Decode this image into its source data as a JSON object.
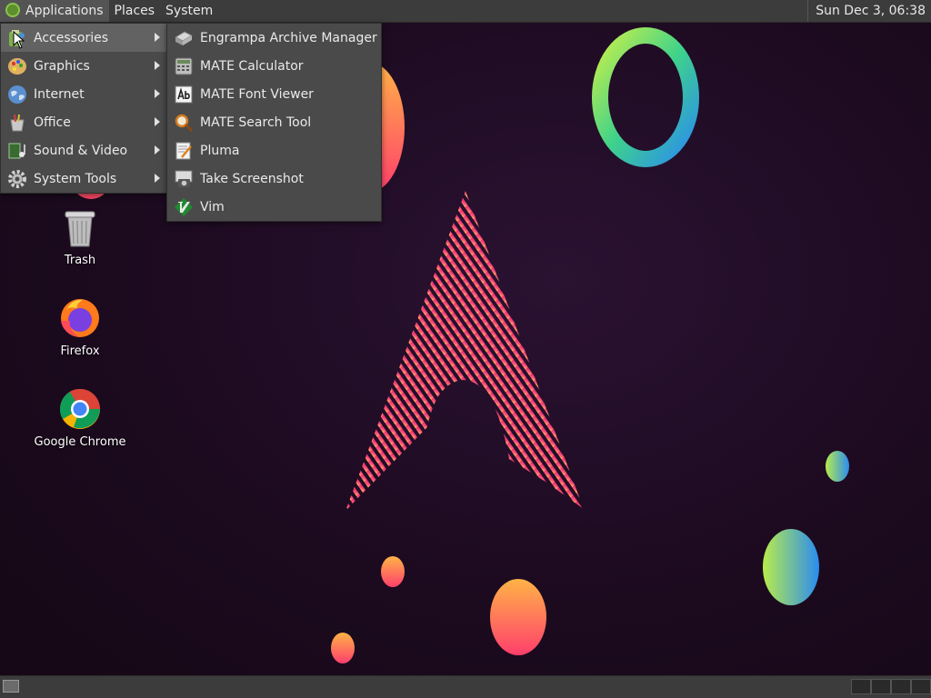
{
  "top_panel": {
    "menus": [
      "Applications",
      "Places",
      "System"
    ],
    "clock": "Sun Dec  3, 06:38"
  },
  "applications_menu": [
    {
      "label": "Accessories",
      "icon": "accessories-icon",
      "highlighted": true
    },
    {
      "label": "Graphics",
      "icon": "graphics-icon"
    },
    {
      "label": "Internet",
      "icon": "internet-globe-icon"
    },
    {
      "label": "Office",
      "icon": "office-icon"
    },
    {
      "label": "Sound & Video",
      "icon": "sound-video-icon"
    },
    {
      "label": "System Tools",
      "icon": "system-tools-gear-icon"
    }
  ],
  "accessories_submenu": [
    {
      "label": "Engrampa Archive Manager",
      "icon": "archive-manager-icon"
    },
    {
      "label": "MATE Calculator",
      "icon": "calculator-icon"
    },
    {
      "label": "MATE Font Viewer",
      "icon": "font-viewer-icon"
    },
    {
      "label": "MATE Search Tool",
      "icon": "search-tool-icon"
    },
    {
      "label": "Pluma",
      "icon": "text-editor-icon"
    },
    {
      "label": "Take Screenshot",
      "icon": "screenshot-camera-icon"
    },
    {
      "label": "Vim",
      "icon": "vim-icon"
    }
  ],
  "desktop_icons": [
    {
      "label": "Trash",
      "icon": "trash-icon"
    },
    {
      "label": "Firefox",
      "icon": "firefox-icon"
    },
    {
      "label": "Google Chrome",
      "icon": "chrome-icon"
    }
  ],
  "colors": {
    "panel": "#3c3c3c",
    "menu_bg": "#4a4a4a",
    "menu_highlight": "#626262",
    "desktop_bg": "#1c0a1f"
  }
}
